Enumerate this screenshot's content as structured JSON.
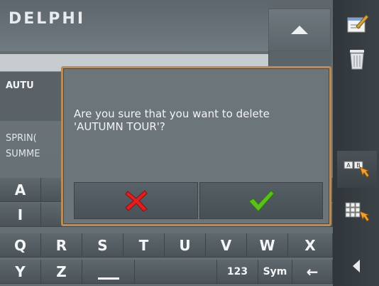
{
  "header": {
    "logo": "DELPHI"
  },
  "list": {
    "selected_item": "AUTU",
    "items": [
      "SPRIN(",
      "SUMME"
    ]
  },
  "keyboard": {
    "row1": [
      "A"
    ],
    "row2": [
      "I"
    ],
    "row3": [
      "Q",
      "R",
      "S",
      "T",
      "U",
      "V",
      "W",
      "X"
    ],
    "row4": [
      "Y",
      "Z",
      "",
      "",
      "123",
      "Sym",
      "←"
    ]
  },
  "dialog": {
    "message": "Are you sure that you want to delete 'AUTUMN TOUR'?",
    "cancel_icon": "red-x-icon",
    "confirm_icon": "green-check-icon"
  },
  "sidebar": {
    "icons": [
      "edit-icon",
      "trash-icon",
      "ab-keyboard-icon",
      "grid-keyboard-icon",
      "back-arrow-icon"
    ]
  },
  "colors": {
    "dialog_border": "#b78d5d",
    "cancel": "#e02020",
    "confirm": "#5cbf1c"
  }
}
